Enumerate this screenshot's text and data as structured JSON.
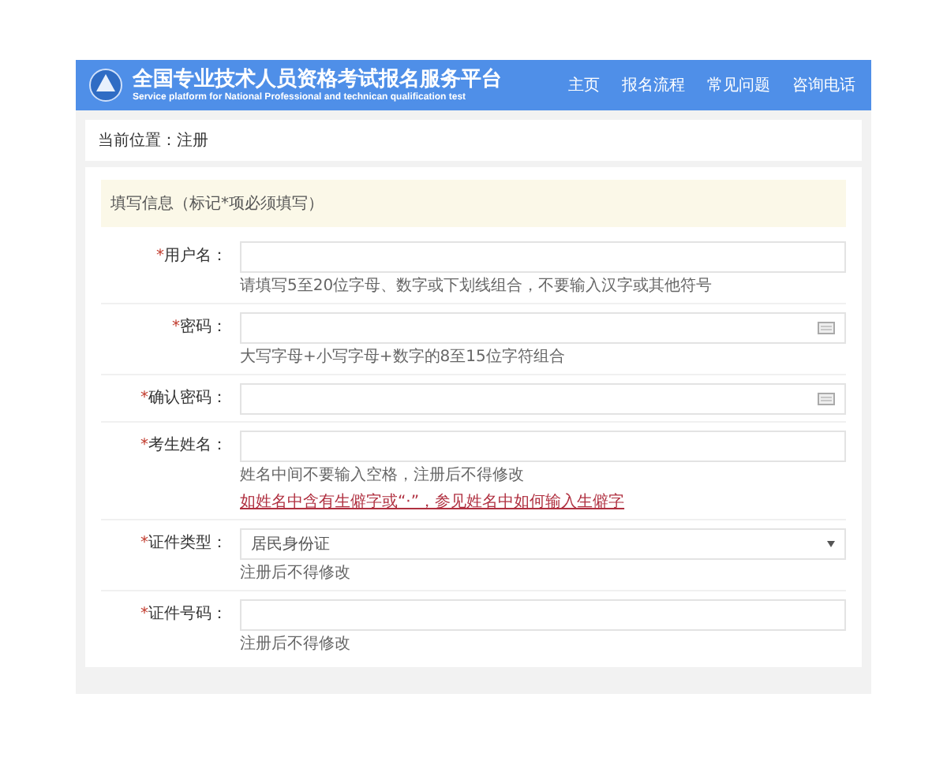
{
  "header": {
    "title": "全国专业技术人员资格考试报名服务平台",
    "subtitle": "Service platform for National Professional and technican qualification test",
    "nav": [
      "主页",
      "报名流程",
      "常见问题",
      "咨询电话"
    ]
  },
  "breadcrumb": "当前位置：注册",
  "notice": "填写信息（标记*项必须填写）",
  "fields": [
    {
      "kind": "text",
      "mark": "*",
      "label": "用户名：",
      "hint": "请填写5至20位字母、数字或下划线组合，不要输入汉字或其他符号"
    },
    {
      "kind": "password",
      "mark": "*",
      "label": "密码：",
      "hint": "大写字母+小写字母+数字的8至15位字符组合"
    },
    {
      "kind": "password",
      "mark": "*",
      "label": "确认密码："
    },
    {
      "kind": "text",
      "mark": "*",
      "label": "考生姓名：",
      "hint": "姓名中间不要输入空格，注册后不得修改",
      "link": "如姓名中含有生僻字或“·”，参见姓名中如何输入生僻字"
    },
    {
      "kind": "select",
      "mark": "*",
      "label": "证件类型：",
      "value": "居民身份证",
      "hint": "注册后不得修改"
    },
    {
      "kind": "text",
      "mark": "*",
      "label": "证件号码：",
      "hint": "注册后不得修改"
    }
  ]
}
